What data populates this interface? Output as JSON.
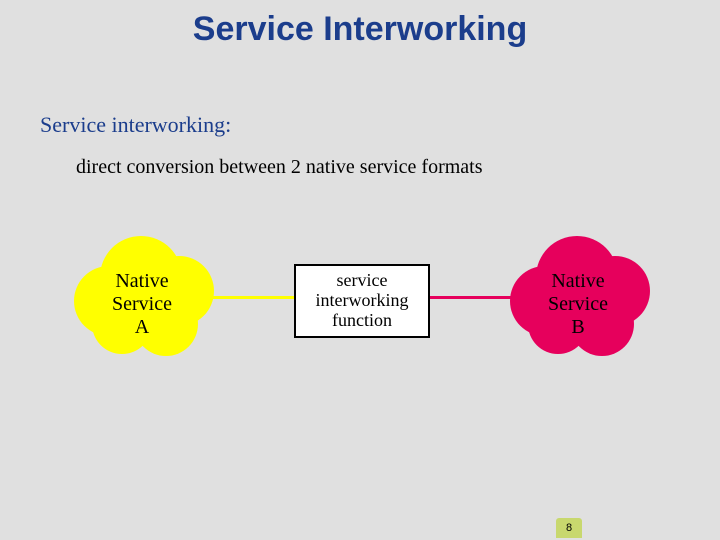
{
  "title": "Service Interworking",
  "subheading": "Service interworking:",
  "description": "direct conversion between 2 native service formats",
  "cloud_a": {
    "line1": "Native",
    "line2": "Service",
    "line3": "A"
  },
  "cloud_b": {
    "line1": "Native",
    "line2": "Service",
    "line3": "B"
  },
  "iwf": {
    "line1": "service",
    "line2": "interworking",
    "line3": "function"
  },
  "page_number": "8",
  "colors": {
    "title": "#1b3d8c",
    "cloud_a": "#ffff00",
    "cloud_b": "#e6005c"
  }
}
